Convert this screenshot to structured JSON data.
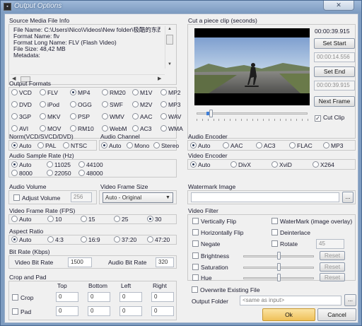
{
  "window": {
    "title": "Output Options",
    "close_glyph": "✕"
  },
  "source_info": {
    "title": "Source Media File Info",
    "lines": [
      "File Name: C:\\Users\\Nico\\Videos\\New folder\\极酷的东西",
      "Format Name: flv",
      "Format Long Name: FLV (Flash Video)",
      "File Size: 48,42 MB",
      "Metadata:"
    ]
  },
  "output_formats": {
    "title": "Output Formats",
    "options": [
      "VCD",
      "FLV",
      "MP4",
      "RM20",
      "M1V",
      "MP2",
      "DVD",
      "iPod",
      "OGG",
      "SWF",
      "M2V",
      "MP3",
      "3GP",
      "MKV",
      "PSP",
      "WMV",
      "AAC",
      "WAV",
      "AVI",
      "MOV",
      "RM10",
      "WebM",
      "AC3",
      "WMA"
    ],
    "selected": "MP4"
  },
  "norm": {
    "title": "Norm(VCD/SVCD/DVD)",
    "options": [
      "Auto",
      "PAL",
      "NTSC"
    ],
    "selected": "Auto"
  },
  "audio_channel": {
    "title": "Audio Channel",
    "options": [
      "Auto",
      "Mono",
      "Stereo"
    ],
    "selected": "Auto"
  },
  "audio_sample_rate": {
    "title": "Audio Sample Rate (Hz)",
    "options": [
      "Auto",
      "11025",
      "44100",
      "8000",
      "22050",
      "48000"
    ],
    "selected": "Auto"
  },
  "audio_volume": {
    "title": "Audio Volume",
    "adjust_label": "Adjust Volume",
    "volume_value": "256"
  },
  "video_frame_size": {
    "title": "Video Frame Size",
    "selected": "Auto - Original"
  },
  "video_frame_rate": {
    "title": "Video Frame Rate (FPS)",
    "options": [
      "Auto",
      "10",
      "15",
      "25",
      "30"
    ],
    "selected": "30"
  },
  "aspect_ratio": {
    "title": "Aspect Ratio",
    "options": [
      "Auto",
      "4:3",
      "16:9",
      "37:20",
      "47:20"
    ],
    "selected": "Auto"
  },
  "bit_rate": {
    "title": "Bit Rate (Kbps)",
    "video_label": "Video Bit Rate",
    "video_value": "1500",
    "audio_label": "Audio Bit Rate",
    "audio_value": "320"
  },
  "crop_pad": {
    "title": "Crop and Pad",
    "headers": [
      "Top",
      "Bottom",
      "Left",
      "Right"
    ],
    "crop_label": "Crop",
    "pad_label": "Pad",
    "crop_values": [
      "0",
      "0",
      "0",
      "0"
    ],
    "pad_values": [
      "0",
      "0",
      "0",
      "0"
    ]
  },
  "clip": {
    "title": "Cut a piece clip (seconds)",
    "duration": "00:00:39.915",
    "start_value": "00:00:14.556",
    "end_value": "00:00:39.915",
    "set_start_label": "Set Start",
    "set_end_label": "Set End",
    "next_frame_label": "Next Frame",
    "cut_clip_label": "Cut Clip",
    "cut_clip_checked": true,
    "position_fraction": 0.13
  },
  "audio_encoder": {
    "title": "Audio Encoder",
    "options": [
      "Auto",
      "AAC",
      "AC3",
      "FLAC",
      "MP3"
    ],
    "selected": "Auto"
  },
  "video_encoder": {
    "title": "Video Encoder",
    "options": [
      "Auto",
      "DivX",
      "XviD",
      "X264"
    ],
    "selected": "Auto"
  },
  "watermark": {
    "title": "Watermark Image",
    "browse_label": "..."
  },
  "video_filter": {
    "title": "Video Filter",
    "vertically_flip": "Vertically Flip",
    "horizontally_flip": "Horizontally Flip",
    "negate": "Negate",
    "watermark_overlay": "WaterMark (image overlay)",
    "deinterlace": "Deinterlace",
    "rotate": "Rotate",
    "rotate_value": "45",
    "brightness": "Brightness",
    "saturation": "Saturation",
    "hue": "Hue",
    "reset_label": "Reset",
    "brightness_level": 0.5,
    "saturation_level": 0.5,
    "hue_level": 0.5
  },
  "output": {
    "overwrite_label": "Overwrite Existing File",
    "folder_label": "Output Folder",
    "folder_placeholder": "<same as input>",
    "browse_label": "...",
    "ok_label": "Ok",
    "cancel_label": "Cancel"
  },
  "colors": {
    "frame": "#7e9cc0",
    "dialog": "#f0f0f0",
    "ok_button": "#f3c766",
    "title_text": "#eef3fa"
  }
}
